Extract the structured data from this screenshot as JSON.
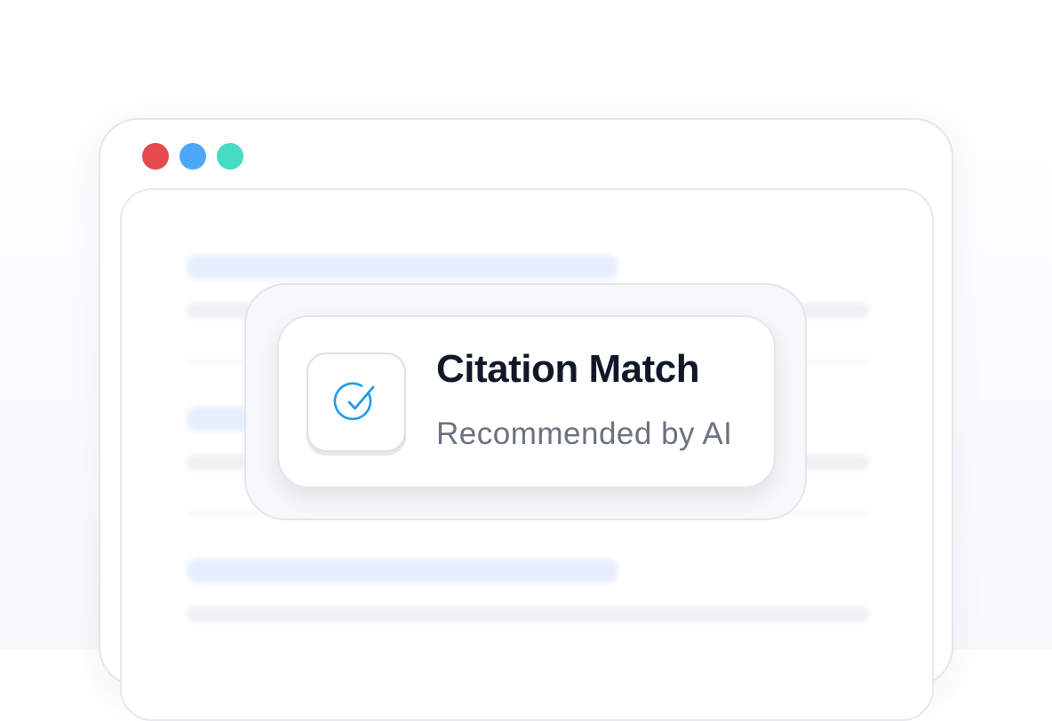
{
  "window": {
    "controls": [
      {
        "name": "close",
        "color": "#e5484d"
      },
      {
        "name": "minimize",
        "color": "#4ea8fa"
      },
      {
        "name": "maximize",
        "color": "#44dcc2"
      }
    ]
  },
  "card": {
    "icon": "check-circle-icon",
    "icon_color": "#1f9bea",
    "title": "Citation Match",
    "subtitle": "Recommended by AI"
  }
}
